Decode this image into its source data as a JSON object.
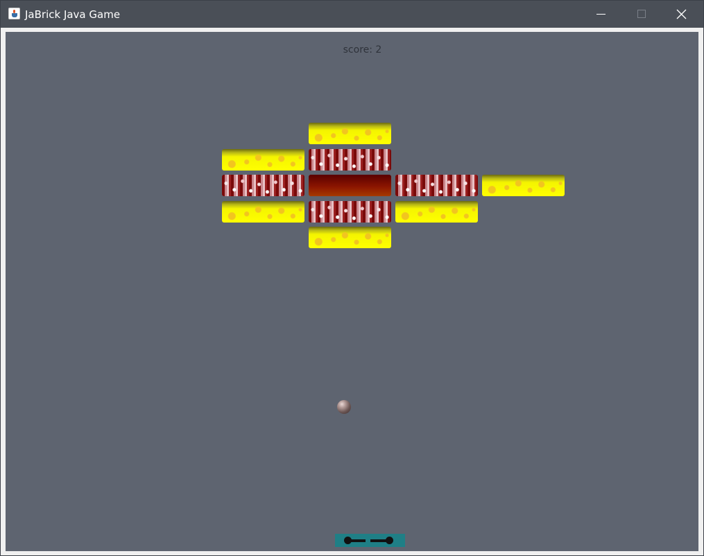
{
  "window": {
    "title": "JaBrick Java Game",
    "icon": "java-cup-icon",
    "controls": [
      "minimize-icon",
      "maximize-icon",
      "close-icon"
    ]
  },
  "game": {
    "score_label": "score: 2",
    "background_color": "#5e6470",
    "bricks": [
      {
        "row": 0,
        "col": 1,
        "type": "yellow"
      },
      {
        "row": 1,
        "col": 0,
        "type": "yellow"
      },
      {
        "row": 1,
        "col": 1,
        "type": "speckle"
      },
      {
        "row": 2,
        "col": 0,
        "type": "speckle"
      },
      {
        "row": 2,
        "col": 1,
        "type": "solid"
      },
      {
        "row": 2,
        "col": 2,
        "type": "speckle"
      },
      {
        "row": 2,
        "col": 3,
        "type": "yellow"
      },
      {
        "row": 3,
        "col": 0,
        "type": "yellow"
      },
      {
        "row": 3,
        "col": 1,
        "type": "speckle"
      },
      {
        "row": 3,
        "col": 2,
        "type": "yellow"
      },
      {
        "row": 4,
        "col": 1,
        "type": "yellow"
      }
    ],
    "brick_colors": {
      "yellow": "#ffff00",
      "speckle": "#9b2020",
      "solid": "#8b1500"
    },
    "ball_color": "#7a6462",
    "paddle_color": "#1f7f86"
  }
}
